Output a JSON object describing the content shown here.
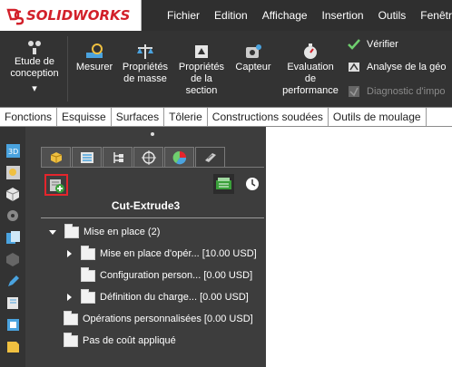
{
  "app": {
    "logo_text": "SOLIDWORKS"
  },
  "menu": [
    "Fichier",
    "Edition",
    "Affichage",
    "Insertion",
    "Outils",
    "Fenêtre"
  ],
  "ribbon": {
    "study": [
      "Etude de",
      "conception"
    ],
    "measure": "Mesurer",
    "mass_props": [
      "Propriétés",
      "de masse"
    ],
    "section_props": [
      "Propriétés",
      "de la",
      "section"
    ],
    "sensor": "Capteur",
    "perf_eval": [
      "Evaluation",
      "de",
      "performance"
    ],
    "verify": "Vérifier",
    "geom_analysis": "Analyse de la géo",
    "import_diag": "Diagnostic d'impo"
  },
  "command_tabs": [
    "Fonctions",
    "Esquisse",
    "Surfaces",
    "Tôlerie",
    "Constructions soudées",
    "Outils de moulage"
  ],
  "left_strip_icons": [
    "3d-box-icon",
    "palette-icon",
    "cube-view-icon",
    "gear-cube-icon",
    "design-library-icon",
    "grey-cube-icon",
    "pencil-icon",
    "book-icon",
    "cube-blue-icon",
    "cube-sheet-icon"
  ],
  "panel_tabs": [
    "feature-manager-icon",
    "property-manager-icon",
    "configuration-manager-icon",
    "dimxpert-icon",
    "display-manager-icon",
    "costing-icon"
  ],
  "costing": {
    "title": "Cut-Extrude3",
    "tree": [
      {
        "label": "Mise en place (2)",
        "indent": 0,
        "caret": "down"
      },
      {
        "label": "Mise en place d'opér... [10.00 USD]",
        "indent": 1,
        "caret": "right"
      },
      {
        "label": "Configuration person... [0.00 USD]",
        "indent": 1,
        "caret": "none"
      },
      {
        "label": "Définition du charge... [0.00 USD]",
        "indent": 1,
        "caret": "right"
      },
      {
        "label": "Opérations personnalisées [0.00 USD]",
        "indent": 0,
        "caret": "none"
      },
      {
        "label": "Pas de coût appliqué",
        "indent": 0,
        "caret": "none"
      }
    ]
  },
  "colors": {
    "accent": "#e4252c",
    "panel": "#3d3d3d",
    "ribbon": "#333333"
  }
}
